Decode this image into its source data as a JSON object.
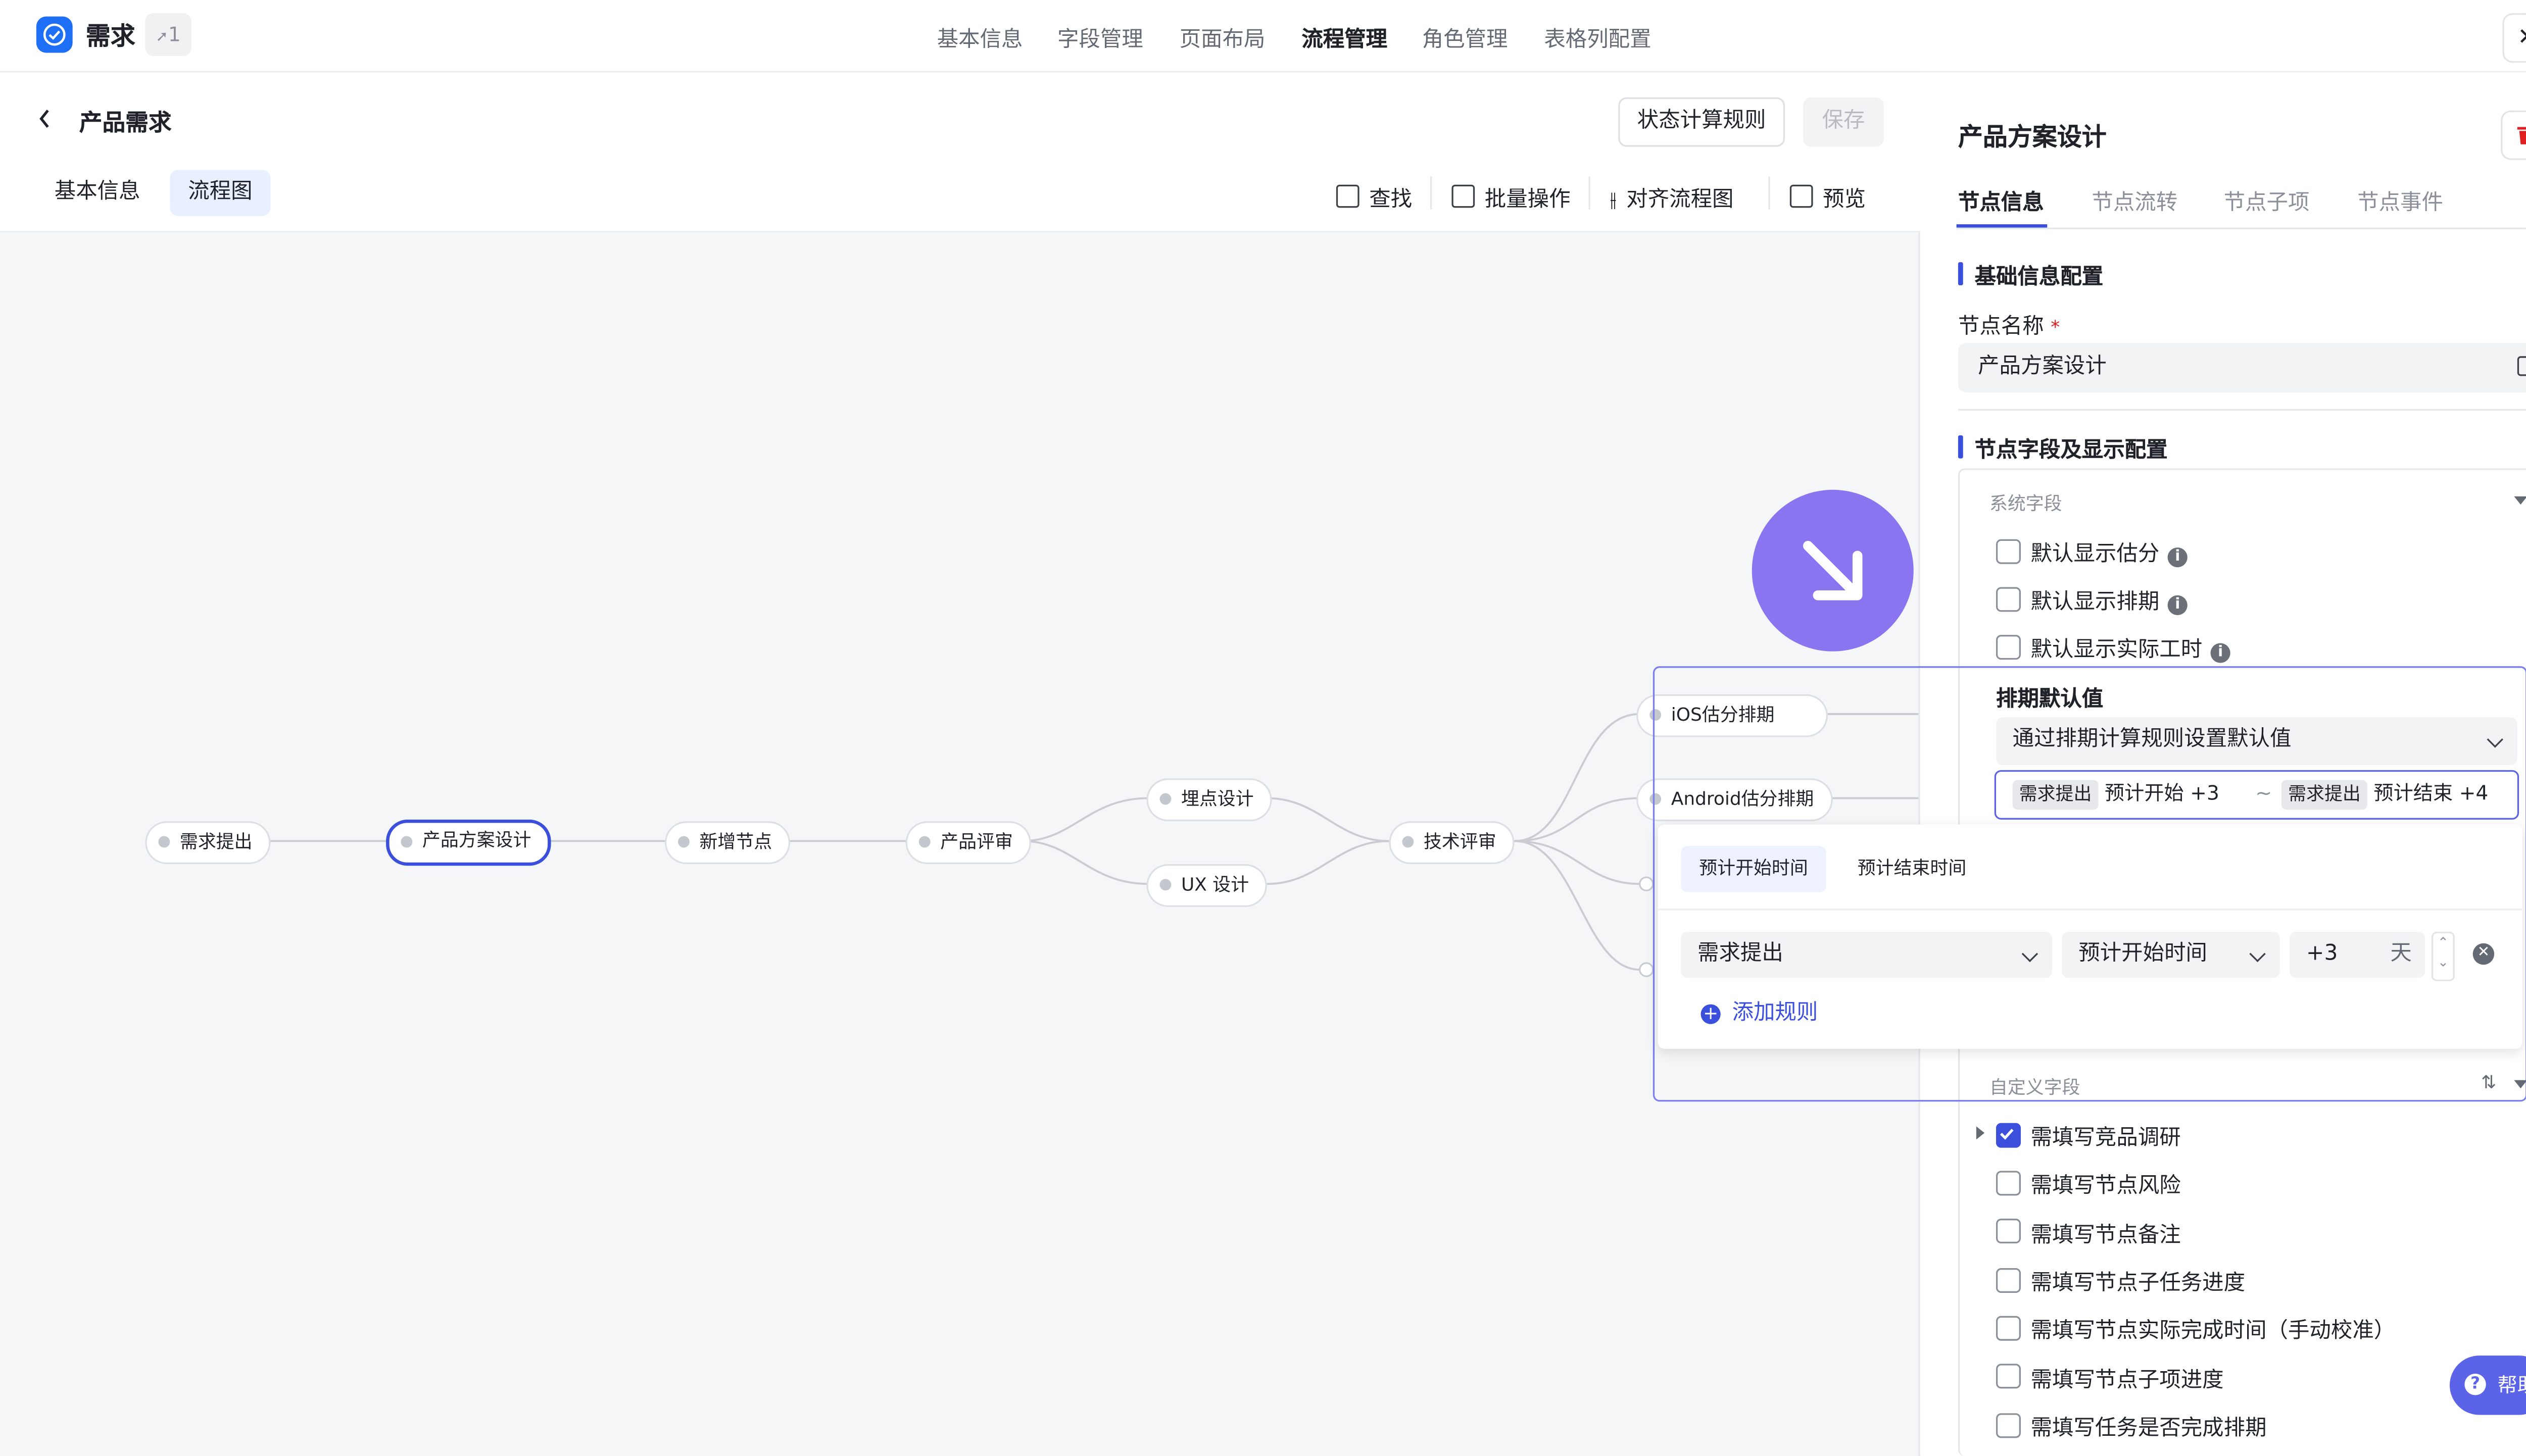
{
  "app": {
    "title": "需求",
    "badge_count": "1",
    "close_glyph": "✕"
  },
  "top_nav": [
    {
      "label": "基本信息",
      "active": false
    },
    {
      "label": "字段管理",
      "active": false
    },
    {
      "label": "页面布局",
      "active": false
    },
    {
      "label": "流程管理",
      "active": true
    },
    {
      "label": "角色管理",
      "active": false
    },
    {
      "label": "表格列配置",
      "active": false
    }
  ],
  "page": {
    "title": "产品需求",
    "btn_status_rule": "状态计算规则",
    "btn_save": "保存",
    "subtabs": [
      {
        "label": "基本信息",
        "active": false
      },
      {
        "label": "流程图",
        "active": true
      }
    ],
    "tools": [
      "查找",
      "批量操作",
      "对齐流程图",
      "预览"
    ]
  },
  "flow_nodes": [
    {
      "label": "需求提出",
      "selected": false
    },
    {
      "label": "产品方案设计",
      "selected": true
    },
    {
      "label": "新增节点",
      "selected": false
    },
    {
      "label": "产品评审",
      "selected": false
    },
    {
      "label": "埋点设计",
      "selected": false
    },
    {
      "label": "UX 设计",
      "selected": false
    },
    {
      "label": "技术评审",
      "selected": false
    },
    {
      "label": "iOS估分排期",
      "selected": false
    },
    {
      "label": "Android估分排期",
      "selected": false
    }
  ],
  "right_panel": {
    "title": "产品方案设计",
    "tabs": [
      {
        "label": "节点信息",
        "active": true
      },
      {
        "label": "节点流转",
        "active": false
      },
      {
        "label": "节点子项",
        "active": false
      },
      {
        "label": "节点事件",
        "active": false
      }
    ],
    "section_basic": "基础信息配置",
    "node_name_label": "节点名称",
    "required_mark": "*",
    "node_name_value": "产品方案设计",
    "section_fields": "节点字段及显示配置",
    "system_fields_label": "系统字段",
    "system_fields": [
      {
        "label": "默认显示估分",
        "checked": false
      },
      {
        "label": "默认显示排期",
        "checked": false
      },
      {
        "label": "默认显示实际工时",
        "checked": false
      }
    ],
    "custom_fields_label": "自定义字段",
    "custom_fields": [
      {
        "label": "需填写竞品调研",
        "checked": true
      },
      {
        "label": "需填写节点风险",
        "checked": false
      },
      {
        "label": "需填写节点备注",
        "checked": false
      },
      {
        "label": "需填写节点子任务进度",
        "checked": false
      },
      {
        "label": "需填写节点实际完成时间（手动校准）",
        "checked": false
      },
      {
        "label": "需填写节点子项进度",
        "checked": false
      },
      {
        "label": "需填写任务是否完成排期",
        "checked": false
      }
    ]
  },
  "schedule_popup": {
    "title": "排期默认值",
    "mode_select": "通过排期计算规则设置默认值",
    "range": {
      "start_chip": "需求提出",
      "start_text": "预计开始 +3",
      "separator": "~",
      "end_chip": "需求提出",
      "end_text": "预计结束 +4"
    },
    "tabs": [
      {
        "label": "预计开始时间",
        "active": true
      },
      {
        "label": "预计结束时间",
        "active": false
      }
    ],
    "rule": {
      "node": "需求提出",
      "time_field": "预计开始时间",
      "offset": "+3",
      "unit": "天"
    },
    "add_rule": "添加规则"
  },
  "help": {
    "label": "帮助"
  },
  "colors": {
    "accent": "#3a4fdc",
    "brand": "#1e6ff5",
    "fab": "#8a74ef",
    "danger": "#e02020"
  }
}
